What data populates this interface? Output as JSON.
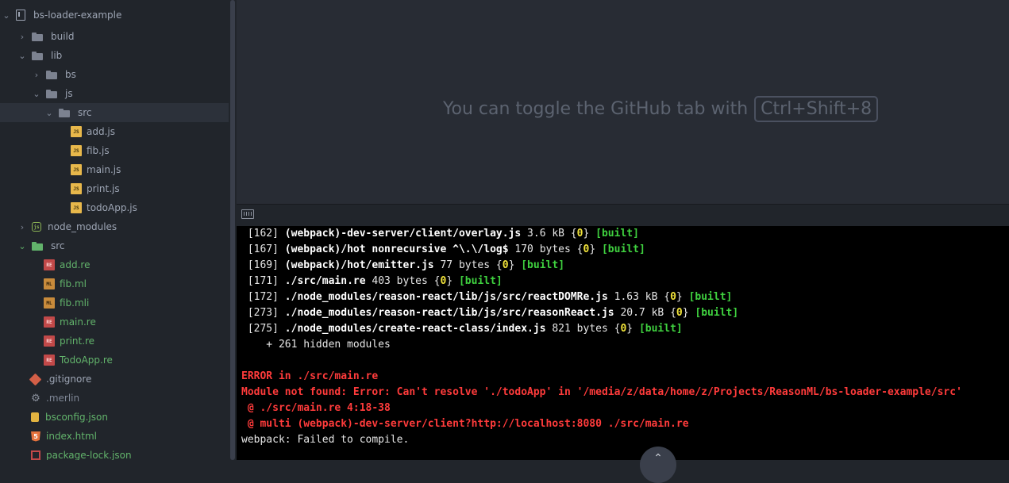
{
  "sidebar": {
    "project": "bs-loader-example",
    "items": {
      "build": "build",
      "lib": "lib",
      "bs": "bs",
      "js": "js",
      "src_lib": "src",
      "add_js": "add.js",
      "fib_js": "fib.js",
      "main_js": "main.js",
      "print_js": "print.js",
      "todoapp_js": "todoApp.js",
      "node_modules": "node_modules",
      "src": "src",
      "add_re": "add.re",
      "fib_ml": "fib.ml",
      "fib_mli": "fib.mli",
      "main_re": "main.re",
      "print_re": "print.re",
      "todoapp_re": "TodoApp.re",
      "gitignore": ".gitignore",
      "merlin": ".merlin",
      "bsconfig": "bsconfig.json",
      "index_html": "index.html",
      "package_lock": "package-lock.json"
    },
    "icon_labels": {
      "js": "JS",
      "re": "RE",
      "ml": "ML",
      "node": "js",
      "html": "5"
    }
  },
  "main": {
    "hint_text": "You can toggle the GitHub tab with",
    "hint_shortcut": "Ctrl+Shift+8"
  },
  "terminal": {
    "lines": [
      {
        "id": "[162]",
        "path": "(webpack)-dev-server/client/overlay.js",
        "size": "3.6 kB",
        "chunk": "0",
        "tag": "[built]"
      },
      {
        "id": "[167]",
        "path": "(webpack)/hot nonrecursive ^\\.\\/log$",
        "size": "170 bytes",
        "chunk": "0",
        "tag": "[built]"
      },
      {
        "id": "[169]",
        "path": "(webpack)/hot/emitter.js",
        "size": "77 bytes",
        "chunk": "0",
        "tag": "[built]"
      },
      {
        "id": "[171]",
        "path": "./src/main.re",
        "size": "403 bytes",
        "chunk": "0",
        "tag": "[built]"
      },
      {
        "id": "[172]",
        "path": "./node_modules/reason-react/lib/js/src/reactDOMRe.js",
        "size": "1.63 kB",
        "chunk": "0",
        "tag": "[built]"
      },
      {
        "id": "[273]",
        "path": "./node_modules/reason-react/lib/js/src/reasonReact.js",
        "size": "20.7 kB",
        "chunk": "0",
        "tag": "[built]"
      },
      {
        "id": "[275]",
        "path": "./node_modules/create-react-class/index.js",
        "size": "821 bytes",
        "chunk": "0",
        "tag": "[built]"
      }
    ],
    "hidden": "    + 261 hidden modules",
    "error_title": "ERROR in ./src/main.re",
    "error_msg": "Module not found: Error: Can't resolve './todoApp' in '/media/z/data/home/z/Projects/ReasonML/bs-loader-example/src'",
    "error_at1": " @ ./src/main.re 4:18-38",
    "error_at2": " @ multi (webpack)-dev-server/client?http://localhost:8080 ./src/main.re",
    "final": "webpack: Failed to compile."
  },
  "colors": {
    "sidebar_bg": "#21252b",
    "editor_bg": "#282c34",
    "terminal_bg": "#000000",
    "error": "#ff3b3b",
    "built": "#3fd13f",
    "chunk": "#f0e23a"
  }
}
